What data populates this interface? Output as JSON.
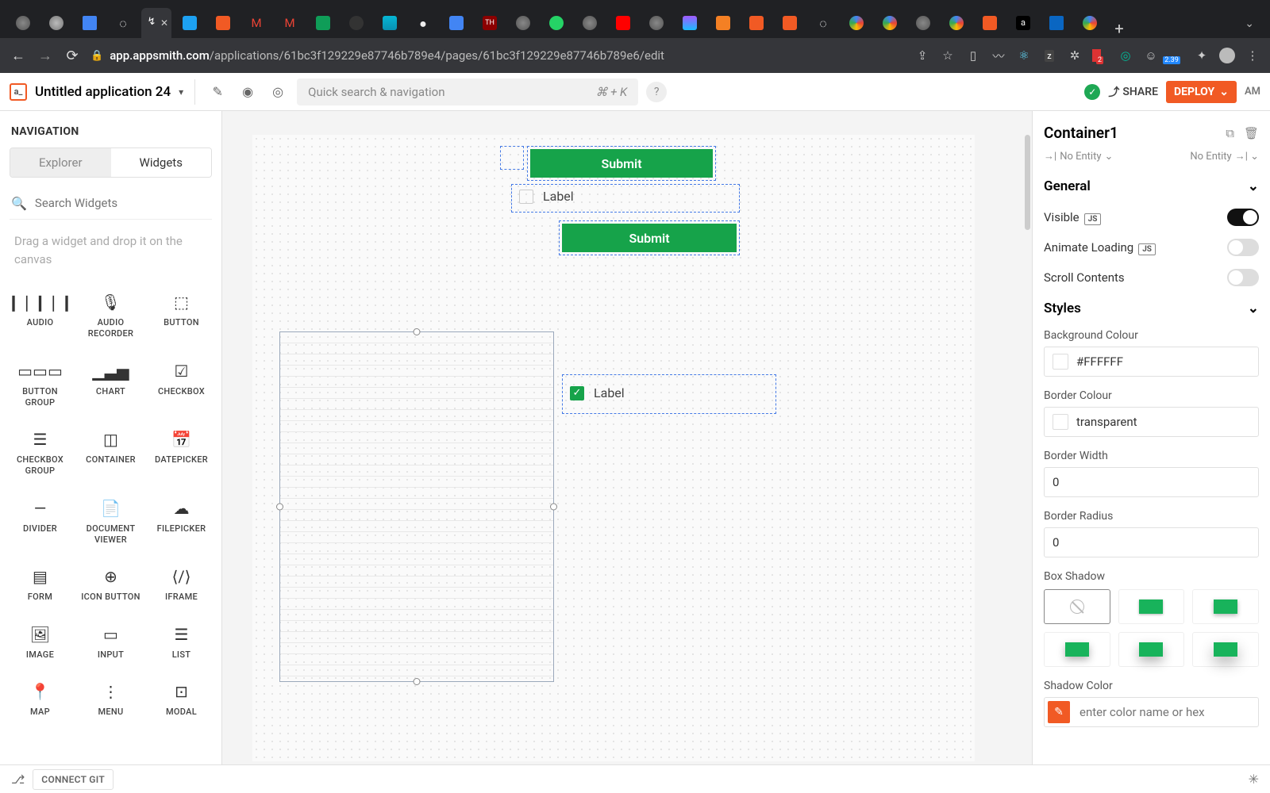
{
  "browser": {
    "url_domain": "app.appsmith.com",
    "url_path": "/applications/61bc3f129229e87746b789e4/pages/61bc3f129229e87746b789e6/edit",
    "ext_badge1": "2",
    "ext_badge2": "2.39"
  },
  "appbar": {
    "title": "Untitled application 24",
    "search_placeholder": "Quick search & navigation",
    "search_shortcut": "⌘ + K",
    "share": "SHARE",
    "deploy": "DEPLOY",
    "avatar": "AM"
  },
  "left": {
    "nav": "NAVIGATION",
    "tab_explorer": "Explorer",
    "tab_widgets": "Widgets",
    "search_placeholder": "Search Widgets",
    "hint": "Drag a widget and drop it on the canvas",
    "widgets": [
      [
        "AUDIO",
        "AUDIO RECORDER",
        "BUTTON"
      ],
      [
        "BUTTON GROUP",
        "CHART",
        "CHECKBOX"
      ],
      [
        "CHECKBOX GROUP",
        "CONTAINER",
        "DATEPICKER"
      ],
      [
        "DIVIDER",
        "DOCUMENT VIEWER",
        "FILEPICKER"
      ],
      [
        "FORM",
        "ICON BUTTON",
        "IFRAME"
      ],
      [
        "IMAGE",
        "INPUT",
        "LIST"
      ],
      [
        "MAP",
        "MENU",
        "MODAL"
      ]
    ]
  },
  "canvas": {
    "btn1": "Submit",
    "chk1": "Label",
    "btn2": "Submit",
    "chk2": "Label"
  },
  "right": {
    "title": "Container1",
    "entity_left": "No Entity",
    "entity_right": "No Entity",
    "section_general": "General",
    "visible": "Visible",
    "animate": "Animate Loading",
    "scroll": "Scroll Contents",
    "section_styles": "Styles",
    "bg_label": "Background Colour",
    "bg_value": "#FFFFFF",
    "bc_label": "Border Colour",
    "bc_value": "transparent",
    "bw_label": "Border Width",
    "bw_value": "0",
    "br_label": "Border Radius",
    "br_value": "0",
    "bs_label": "Box Shadow",
    "sc_label": "Shadow Color",
    "sc_placeholder": "enter color name or hex",
    "js": "JS"
  },
  "bottom": {
    "git": "CONNECT GIT"
  }
}
